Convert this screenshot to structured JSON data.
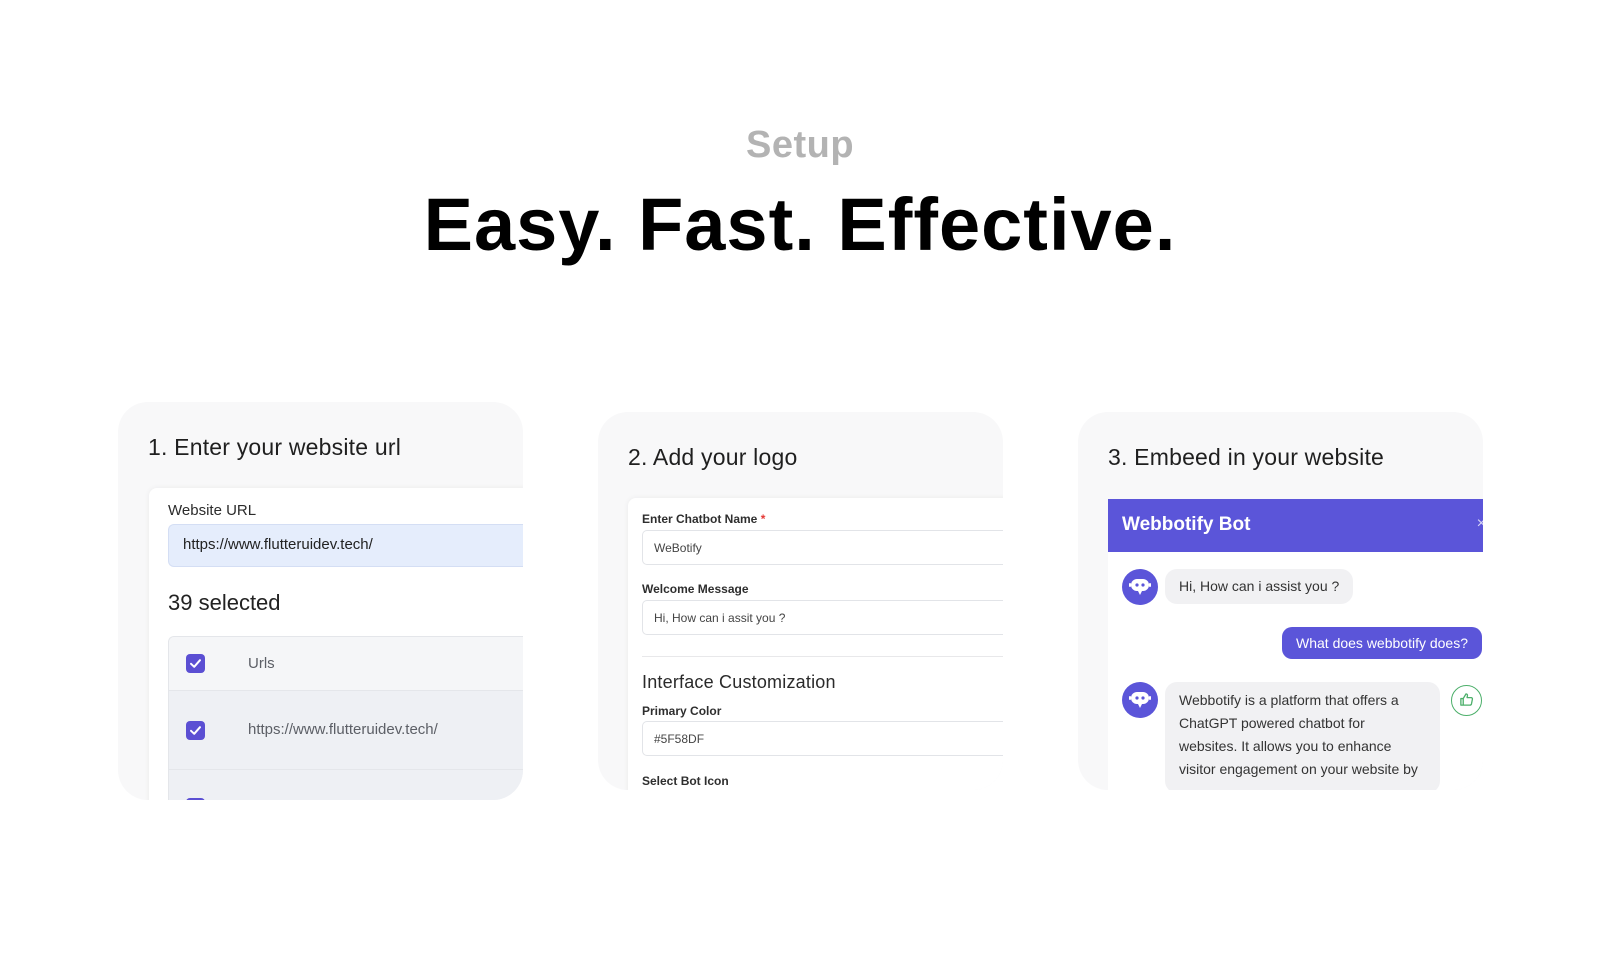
{
  "header": {
    "eyebrow": "Setup",
    "headline": "Easy. Fast. Effective."
  },
  "step1": {
    "title": "1. Enter your website url",
    "url_label": "Website URL",
    "url_value": "https://www.flutteruidev.tech/",
    "selected_count": "39 selected",
    "table": {
      "header": "Urls",
      "rows": [
        "https://www.flutteruidev.tech/"
      ]
    }
  },
  "step2": {
    "title": "2. Add your logo",
    "chatbot_name_label": "Enter Chatbot Name",
    "required_mark": "*",
    "chatbot_name_value": "WeBotify",
    "welcome_label": "Welcome Message",
    "welcome_value": "Hi, How can i assit you ?",
    "section_title": "Interface Customization",
    "primary_color_label": "Primary Color",
    "primary_color_value": "#5F58DF",
    "bot_icon_label": "Select Bot Icon"
  },
  "step3": {
    "title": "3. Embeed in your website",
    "chat": {
      "bot_name": "Webbotify Bot",
      "close_glyph": "×",
      "messages": [
        {
          "from": "bot",
          "text": "Hi, How can i assist you ?"
        },
        {
          "from": "user",
          "text": "What does webbotify does?"
        },
        {
          "from": "bot",
          "text": "Webbotify is a platform that offers a ChatGPT powered chatbot for websites. It allows you to enhance visitor engagement on your website by"
        }
      ]
    }
  },
  "colors": {
    "accent": "#5B55D9",
    "checkbox": "#5B4FD3",
    "url_input_bg": "#E5EDFC",
    "card_bg": "#F8F8F9"
  },
  "icons": {
    "checkbox": "checkmark-icon",
    "avatar": "bot-icon",
    "like": "thumbs-up-icon"
  }
}
